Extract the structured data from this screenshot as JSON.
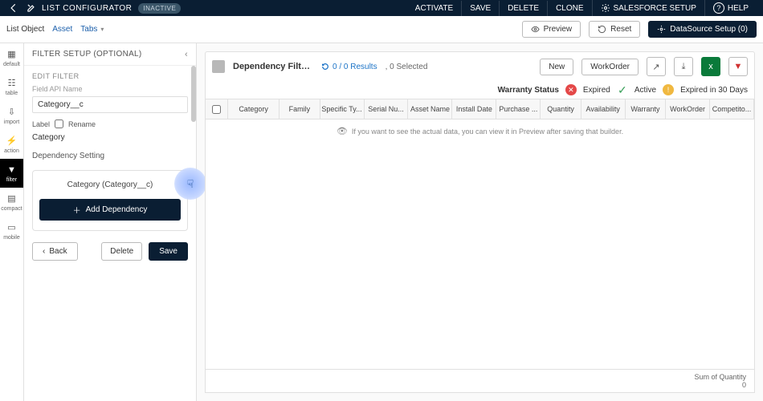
{
  "topbar": {
    "title": "LIST CONFIGURATOR",
    "status_badge": "INACTIVE",
    "buttons": {
      "activate": "ACTIVATE",
      "save": "SAVE",
      "delete": "DELETE",
      "clone": "CLONE",
      "salesforce_setup": "SALESFORCE SETUP",
      "help": "HELP"
    }
  },
  "secondbar": {
    "list_object_label": "List Object",
    "list_object_value": "Asset",
    "tabs_label": "Tabs",
    "preview": "Preview",
    "reset": "Reset",
    "datasource": "DataSource Setup (0)"
  },
  "rail": {
    "items": [
      {
        "label": "default"
      },
      {
        "label": "table"
      },
      {
        "label": "import"
      },
      {
        "label": "action"
      },
      {
        "label": "filter"
      },
      {
        "label": "compact"
      },
      {
        "label": "mobile"
      }
    ]
  },
  "panel": {
    "header": "FILTER SETUP (OPTIONAL)",
    "edit_filter": "EDIT FILTER",
    "field_api_label": "Field API Name",
    "field_api_value": "Category__c",
    "label_label": "Label",
    "rename": "Rename",
    "label_value": "Category",
    "dependency_setting": "Dependency Setting",
    "dep_title": "Category (Category__c)",
    "add_dep": "Add Dependency",
    "back": "Back",
    "delete": "Delete",
    "save": "Save"
  },
  "content": {
    "header_title": "Dependency Filter Setti...",
    "results_count": "0 / 0 Results",
    "selected": "0 Selected",
    "new": "New",
    "workorder": "WorkOrder",
    "warranty_status_label": "Warranty Status",
    "expired": "Expired",
    "active": "Active",
    "expired30": "Expired in 30 Days",
    "columns": [
      "Category",
      "Family",
      "Specific Ty...",
      "Serial Nu...",
      "Asset Name",
      "Install Date",
      "Purchase ...",
      "Quantity",
      "Availability",
      "Warranty",
      "WorkOrder",
      "Competito..."
    ],
    "empty_msg": "If you want to see the actual data, you can view it in Preview after saving that builder.",
    "sum_label": "Sum of Quantity",
    "sum_value": "0"
  }
}
